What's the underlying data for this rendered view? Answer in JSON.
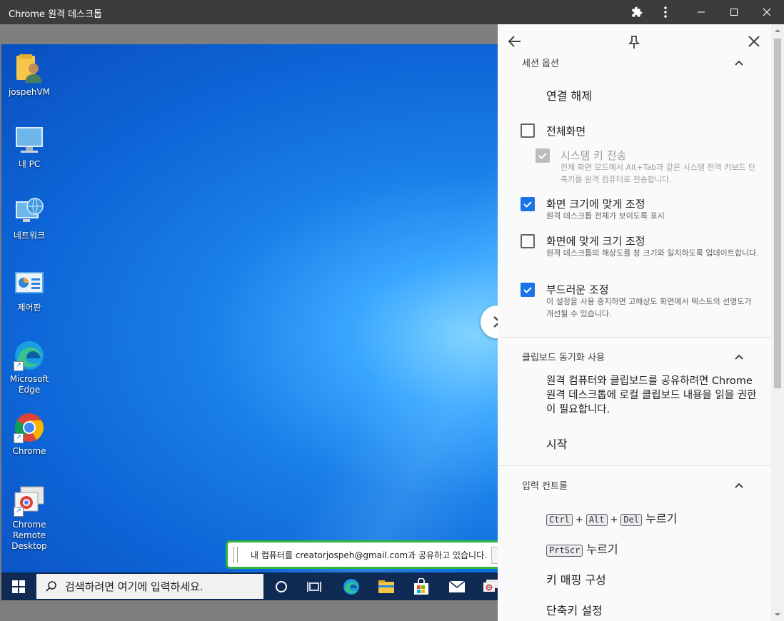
{
  "window": {
    "title": "Chrome 원격 데스크톱",
    "controls": [
      "extensions-icon",
      "more-vert-icon",
      "minimize-icon",
      "maximize-icon",
      "close-icon"
    ]
  },
  "desktop": {
    "icons": [
      {
        "label": "jospehVM",
        "icon": "user-folder-icon"
      },
      {
        "label": "내 PC",
        "icon": "computer-icon"
      },
      {
        "label": "네트워크",
        "icon": "network-icon"
      },
      {
        "label": "제어판",
        "icon": "control-panel-icon"
      },
      {
        "label": "Microsoft Edge",
        "icon": "edge-icon"
      },
      {
        "label": "Chrome",
        "icon": "chrome-icon"
      },
      {
        "label": "Chrome Remote Desktop",
        "icon": "chrome-remote-desktop-icon"
      }
    ]
  },
  "sharing_bar": {
    "text": "내 컴퓨터를 creatorjospeh@gmail.com과 공유하고 있습니다."
  },
  "taskbar": {
    "search_placeholder": "검색하려면 여기에 입력하세요.",
    "apps": [
      "cortana-icon",
      "task-view-icon",
      "edge-icon",
      "file-explorer-icon",
      "store-icon",
      "mail-icon",
      "remote-desktop-icon"
    ]
  },
  "panel": {
    "session": {
      "title": "세션 옵션",
      "disconnect": "연결 해제",
      "options": [
        {
          "label": "전체화면",
          "desc": "",
          "checked": false,
          "disabled": false
        },
        {
          "label": "시스템 키 전송",
          "desc": "전체 화면 모드에서 Alt+Tab과 같은 시스템 전역 키보드 단축키를 원격 컴퓨터로 전송합니다.",
          "checked": true,
          "disabled": true
        },
        {
          "label": "화면 크기에 맞게 조정",
          "desc": "원격 데스크톱 전체가 보이도록 표시",
          "checked": true,
          "disabled": false
        },
        {
          "label": "화면에 맞게 크기 조정",
          "desc": "원격 데스크톱의 해상도를 창 크기와 일치하도록 업데이트합니다.",
          "checked": false,
          "disabled": false
        },
        {
          "label": "부드러운 조정",
          "desc": "이 설정을 사용 중지하면 고해상도 화면에서 텍스트의 선명도가 개선될 수 있습니다.",
          "checked": true,
          "disabled": false
        }
      ]
    },
    "clipboard": {
      "title": "클립보드 동기화 사용",
      "desc": "원격 컴퓨터와 클립보드를 공유하려면 Chrome 원격 데스크톱에 로컬 클립보드 내용을 읽을 권한이 필요합니다.",
      "start": "시작"
    },
    "input": {
      "title": "입력 컨트롤",
      "ctrl_key": "Ctrl",
      "alt_key": "Alt",
      "del_key": "Del",
      "plus": "+",
      "press": "누르기",
      "prtscr_key": "PrtScr",
      "key_mapping": "키 매핑 구성",
      "shortcut_settings": "단축키 설정"
    }
  }
}
